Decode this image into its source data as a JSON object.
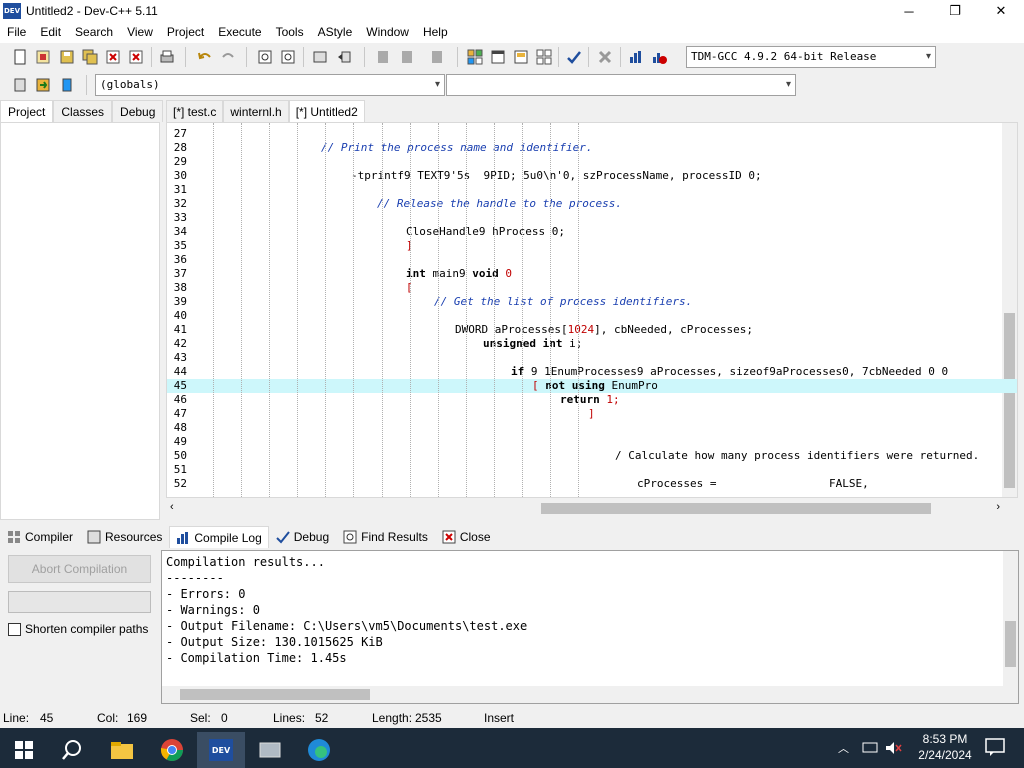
{
  "window": {
    "title": "Untitled2 - Dev-C++ 5.11",
    "app_icon_label": "DEV",
    "minimize": "─",
    "maximize": "❐",
    "close": "✕"
  },
  "menu": [
    "File",
    "Edit",
    "Search",
    "View",
    "Project",
    "Execute",
    "Tools",
    "AStyle",
    "Window",
    "Help"
  ],
  "toolbar": {
    "compiler_select": "TDM-GCC 4.9.2 64-bit Release",
    "scope_select": "(globals)",
    "function_select": ""
  },
  "left_tabs": [
    "Project",
    "Classes",
    "Debug"
  ],
  "editor_tabs": [
    "[*] test.c",
    "winternl.h",
    "[*] Untitled2"
  ],
  "editor_lines": [
    {
      "n": "27",
      "parts": []
    },
    {
      "n": "28",
      "parts": [
        {
          "t": "// Print the process name and identifier.",
          "c": "cmt"
        }
      ],
      "indent": 114
    },
    {
      "n": "29",
      "parts": []
    },
    {
      "n": "30",
      "parts": [
        {
          "t": "-tprintf9 TEXT9'5s  9PID; 5u0\\n'0, szProcessName, processID 0;",
          "c": ""
        }
      ],
      "indent": 144
    },
    {
      "n": "31",
      "parts": []
    },
    {
      "n": "32",
      "parts": [
        {
          "t": "// Release the handle to the process.",
          "c": "cmt"
        }
      ],
      "indent": 170
    },
    {
      "n": "33",
      "parts": []
    },
    {
      "n": "34",
      "parts": [
        {
          "t": "CloseHandle9 hProcess 0;",
          "c": ""
        }
      ],
      "indent": 199
    },
    {
      "n": "35",
      "parts": [
        {
          "t": "]",
          "c": "red"
        }
      ],
      "indent": 199
    },
    {
      "n": "36",
      "parts": []
    },
    {
      "n": "37",
      "parts": [
        {
          "t": "int",
          "c": "kw"
        },
        {
          "t": " main9 ",
          "c": ""
        },
        {
          "t": "void",
          "c": "kw"
        },
        {
          "t": " 0",
          "c": "red"
        }
      ],
      "indent": 199
    },
    {
      "n": "38",
      "parts": [
        {
          "t": "[",
          "c": "red"
        }
      ],
      "indent": 199
    },
    {
      "n": "39",
      "parts": [
        {
          "t": "// Get the list of process identifiers.",
          "c": "cmt"
        }
      ],
      "indent": 227
    },
    {
      "n": "40",
      "parts": []
    },
    {
      "n": "41",
      "parts": [
        {
          "t": "DWORD aProcesses[",
          "c": ""
        },
        {
          "t": "1024",
          "c": "red"
        },
        {
          "t": "], cbNeeded, cProcesses;",
          "c": ""
        }
      ],
      "indent": 248
    },
    {
      "n": "42",
      "parts": [
        {
          "t": "unsigned int",
          "c": "kw"
        },
        {
          "t": " i;",
          "c": ""
        }
      ],
      "indent": 276
    },
    {
      "n": "43",
      "parts": []
    },
    {
      "n": "44",
      "parts": [
        {
          "t": "if",
          "c": "kw"
        },
        {
          "t": " 9 1EnumProcesses9 aProcesses, sizeof9aProcesses0, 7cbNeeded 0 0",
          "c": ""
        }
      ],
      "indent": 304
    },
    {
      "n": "45",
      "parts": [
        {
          "t": "[ ",
          "c": "red"
        },
        {
          "t": "not using",
          "c": "kw"
        },
        {
          "t": " EnumPro",
          "c": ""
        }
      ],
      "indent": 325,
      "highlight": true
    },
    {
      "n": "46",
      "parts": [
        {
          "t": "return",
          "c": "kw"
        },
        {
          "t": " 1;",
          "c": "red"
        }
      ],
      "indent": 353
    },
    {
      "n": "47",
      "parts": [
        {
          "t": "]",
          "c": "red"
        }
      ],
      "indent": 381
    },
    {
      "n": "48",
      "parts": []
    },
    {
      "n": "49",
      "parts": []
    },
    {
      "n": "50",
      "parts": [
        {
          "t": "/ Calculate how many process identifiers were returned.",
          "c": ""
        }
      ],
      "indent": 408
    },
    {
      "n": "51",
      "parts": []
    },
    {
      "n": "52",
      "parts": [
        {
          "t": "cProcesses =                 FALSE,",
          "c": ""
        }
      ],
      "indent": 430
    }
  ],
  "bottom_tabs": [
    "Compiler",
    "Resources",
    "Compile Log",
    "Debug",
    "Find Results",
    "Close"
  ],
  "compile": {
    "abort_label": "Abort Compilation",
    "shorten_label": "Shorten compiler paths",
    "log": [
      "Compilation results...",
      "--------",
      "- Errors: 0",
      "- Warnings: 0",
      "- Output Filename: C:\\Users\\vm5\\Documents\\test.exe",
      "- Output Size: 130.1015625 KiB",
      "- Compilation Time: 1.45s"
    ]
  },
  "status": {
    "line_label": "Line:",
    "line": "45",
    "col_label": "Col:",
    "col": "169",
    "sel_label": "Sel:",
    "sel": "0",
    "lines_label": "Lines:",
    "lines": "52",
    "length_label": "Length:",
    "length": "2535",
    "mode": "Insert"
  },
  "taskbar": {
    "time": "8:53 PM",
    "date": "2/24/2024"
  }
}
